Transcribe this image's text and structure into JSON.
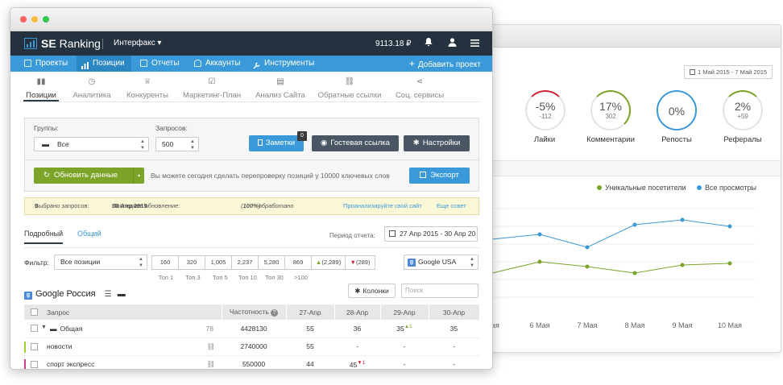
{
  "colors": {
    "accent": "#3a99d8",
    "topbar": "#243240",
    "green": "#7ba428",
    "red": "#d0253c"
  },
  "background_window": {
    "date_range": "1 Май 2015 - 7 Май 2015",
    "stats": [
      {
        "value": "-5%",
        "sub": "-112",
        "label": "Лайки"
      },
      {
        "value": "17%",
        "sub": "302",
        "label": "Комментарии"
      },
      {
        "value": "0%",
        "sub": "",
        "label": "Репосты"
      },
      {
        "value": "2%",
        "sub": "+59",
        "label": "Рефералы"
      }
    ],
    "legend": {
      "unique": "Уникальные посетители",
      "views": "Все просмотры"
    },
    "chart_data": {
      "type": "line",
      "x": [
        "Мая",
        "6 Мая",
        "7 Мая",
        "8 Мая",
        "9 Мая",
        "10 Мая"
      ],
      "series": [
        {
          "name": "Все просмотры",
          "values": [
            46,
            49,
            41,
            55,
            58,
            54
          ]
        },
        {
          "name": "Уникальные посетители",
          "values": [
            25,
            32,
            29,
            25,
            30,
            31
          ]
        }
      ],
      "ylim": [
        0,
        70
      ]
    }
  },
  "app": {
    "logo_bold": "SE",
    "logo_rest": " Ranking",
    "project": "Интерфакс ▾",
    "balance": "9113.18 ₽"
  },
  "nav": {
    "items": [
      "Проекты",
      "Позиции",
      "Отчеты",
      "Аккаунты",
      "Инструменты"
    ],
    "add_project": "Добавить проект"
  },
  "subnav": [
    "Позиции",
    "Аналитика",
    "Конкуренты",
    "Маркетинг-План",
    "Анализ Сайта",
    "Обратные ссылки",
    "Соц. сервисы"
  ],
  "controls": {
    "groups_label": "Группы:",
    "groups_value": "Все",
    "queries_label": "Запросов:",
    "queries_value": "500",
    "notes": "Заметки",
    "notes_badge": "0",
    "guest_link": "Гостевая ссылка",
    "settings": "Настройки",
    "refresh": "Обновить данные",
    "refresh_note": "Вы можете сегодня сделать перепроверку позиций у 10000 ключевых слов",
    "export": "Экспорт"
  },
  "info": {
    "selected_label": "Выбрано запросов:",
    "selected_value": "0",
    "updated_label": "Последнее обновление:",
    "updated_value": "30 Апр 2015",
    "processed_bold": "100%",
    "processed_rest": " обработано",
    "analyze": "Проанализируйте свой сайт",
    "tip": "Еще совет"
  },
  "view": {
    "tab_detailed": "Подробный",
    "tab_general": "Общий",
    "period_label": "Период отчета:",
    "period_value": "27 Апр 2015 - 30 Апр 20"
  },
  "filter": {
    "label": "Фильтр:",
    "value": "Все позиции",
    "counts": [
      "160",
      "320",
      "1,005",
      "2,237",
      "5,280",
      "869"
    ],
    "count_up": "(2,289)",
    "count_down": "(289)",
    "count_labels": [
      "Топ 1",
      "Топ 3",
      "Топ 5",
      "Топ 10",
      "Топ 30",
      ">100"
    ],
    "engine": "Google USA"
  },
  "table": {
    "title": "Google Россия",
    "columns_btn": "Колонки",
    "search_placeholder": "Поиск",
    "headers": [
      "Запрос",
      "Частотность",
      "27-Апр",
      "28-Апр",
      "29-Апр",
      "30-Апр"
    ],
    "rows": [
      {
        "query": "Общая",
        "count": "78",
        "freq": "4428130",
        "d27": "55",
        "d28": "36",
        "d29": "35",
        "d29_delta": "▲1",
        "d30": "35"
      },
      {
        "query": "новости",
        "freq": "2740000",
        "d27": "55",
        "d28": "-",
        "d29": "-",
        "d30": "-"
      },
      {
        "query": "спорт экспресс",
        "freq": "550000",
        "d27": "44",
        "d28": "45",
        "d28_delta": "▼1",
        "d29": "-",
        "d30": "-"
      }
    ]
  }
}
